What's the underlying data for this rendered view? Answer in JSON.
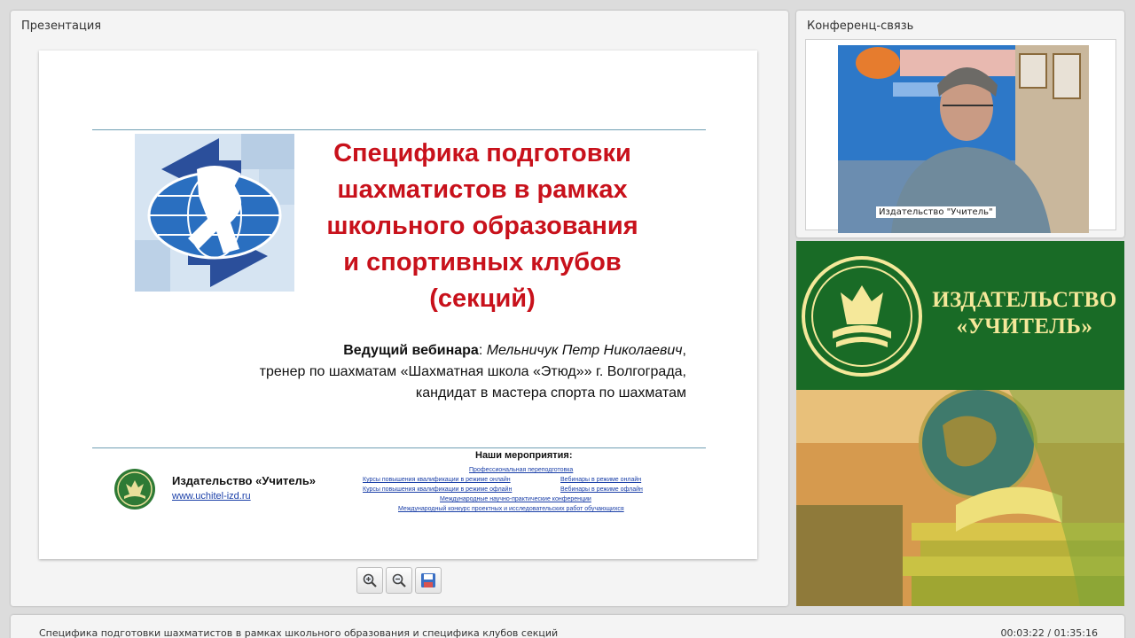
{
  "presentation_panel": {
    "title": "Презентация"
  },
  "conference_panel": {
    "title": "Конференц-связь",
    "camera_label": "Издательство \"Учитель\""
  },
  "slide": {
    "title_lines": [
      "Специфика подготовки",
      "шахматистов в рамках",
      "школьного образования",
      "и спортивных клубов",
      "(секций)"
    ],
    "presenter_label": "Ведущий вебинара",
    "presenter_name": "Мельничук Петр Николаевич",
    "presenter_line2": "тренер по шахматам «Шахматная школа «Этюд»» г. Волгограда,",
    "presenter_line3": "кандидат в мастера спорта по шахматам",
    "footer_brand": "Издательство «Учитель»",
    "footer_link": "www.uchitel-izd.ru",
    "events_title": "Наши мероприятия",
    "events": [
      "Профессиональная переподготовка",
      "Курсы повышения квалификации в режиме онлайн",
      "Вебинары в режиме онлайн",
      "Курсы повышения квалификации в режиме офлайн",
      "Вебинары в режиме офлайн",
      "Международные научно-практические конференции",
      "Международный конкурс проектных и исследовательских работ обучающихся"
    ]
  },
  "toolbar": {
    "zoom_in": "zoom-in",
    "zoom_out": "zoom-out",
    "save": "save"
  },
  "brand": {
    "line1": "ИЗДАТЕЛЬСТВО",
    "line2": "«УЧИТЕЛЬ»"
  },
  "status": {
    "title": "Специфика подготовки шахматистов в рамках школьного образования и специфика клубов секций",
    "time": "00:03:22 / 01:35:16"
  },
  "colors": {
    "slide_title": "#c8111b",
    "brand_green": "#196b26",
    "brand_gold": "#f5e89a",
    "link": "#1a3fa8"
  }
}
